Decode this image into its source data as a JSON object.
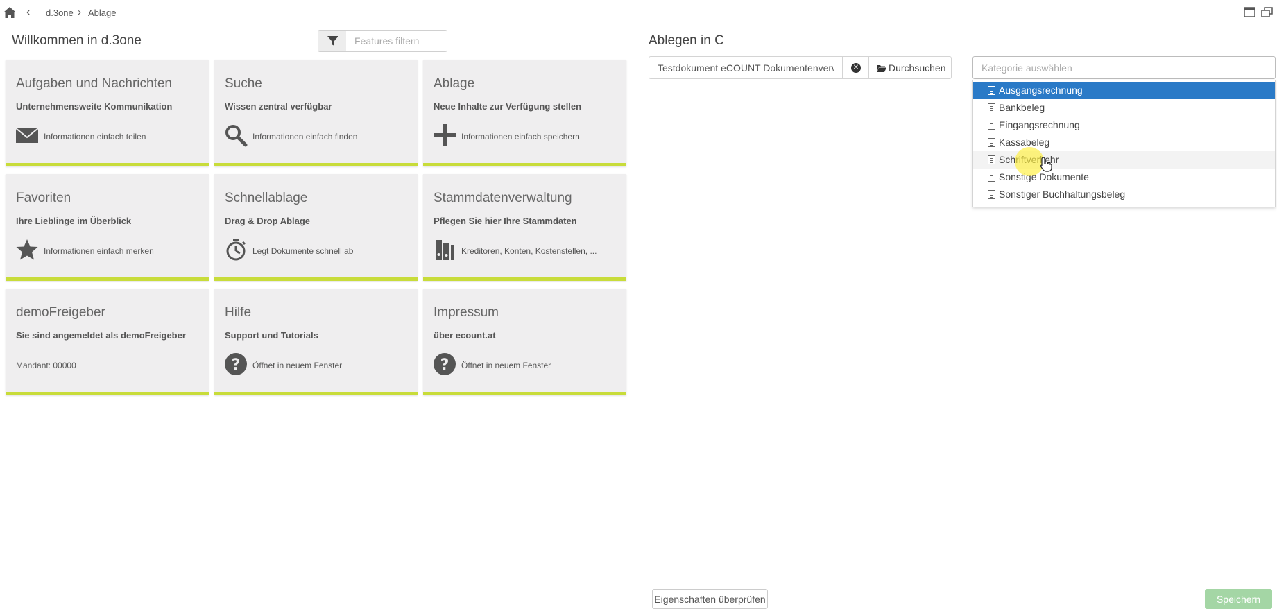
{
  "topbar": {
    "breadcrumbs": [
      "d.3one",
      "Ablage"
    ]
  },
  "left": {
    "title": "Willkommen in d.3one",
    "filter_placeholder": "Features filtern",
    "tiles": [
      {
        "title": "Aufgaben und Nachrichten",
        "subtitle": "Unternehmensweite Kommunikation",
        "desc": "Informationen einfach teilen",
        "icon": "envelope-icon"
      },
      {
        "title": "Suche",
        "subtitle": "Wissen zentral verfügbar",
        "desc": "Informationen einfach finden",
        "icon": "search-icon"
      },
      {
        "title": "Ablage",
        "subtitle": "Neue Inhalte zur Verfügung stellen",
        "desc": "Informationen einfach speichern",
        "icon": "plus-icon"
      },
      {
        "title": "Favoriten",
        "subtitle": "Ihre Lieblinge im Überblick",
        "desc": "Informationen einfach merken",
        "icon": "star-icon"
      },
      {
        "title": "Schnellablage",
        "subtitle": "Drag & Drop Ablage",
        "desc": "Legt Dokumente schnell ab",
        "icon": "stopwatch-icon"
      },
      {
        "title": "Stammdatenverwaltung",
        "subtitle": "Pflegen Sie hier Ihre Stammdaten",
        "desc": "Kreditoren, Konten, Kostenstellen, ...",
        "icon": "binders-icon"
      },
      {
        "title": "demoFreigeber",
        "subtitle": "Sie sind angemeldet als demoFreigeber",
        "desc": "Mandant: 00000",
        "icon": ""
      },
      {
        "title": "Hilfe",
        "subtitle": "Support und Tutorials",
        "desc": "Öffnet in neuem Fenster",
        "icon": "question-icon"
      },
      {
        "title": "Impressum",
        "subtitle": "über ecount.at",
        "desc": "Öffnet in neuem Fenster",
        "icon": "question-icon"
      }
    ]
  },
  "right": {
    "title": "Ablegen in C",
    "file_value": "Testdokument eCOUNT Dokumentenverwaltung",
    "browse_label": "Durchsuchen",
    "category_placeholder": "Kategorie auswählen",
    "categories": [
      "Ausgangsrechnung",
      "Bankbeleg",
      "Eingangsrechnung",
      "Kassabeleg",
      "Schriftverkehr",
      "Sonstige Dokumente",
      "Sonstiger Buchhaltungsbeleg"
    ],
    "selected_category": "Ausgangsrechnung",
    "hovered_category": "Schriftverkehr"
  },
  "footer": {
    "check_label": "Eigenschaften überprüfen",
    "save_label": "Speichern"
  },
  "colors": {
    "accent_green": "#c8dc3a",
    "selected_blue": "#2a7ac7",
    "save_green": "#a4d6a5"
  }
}
